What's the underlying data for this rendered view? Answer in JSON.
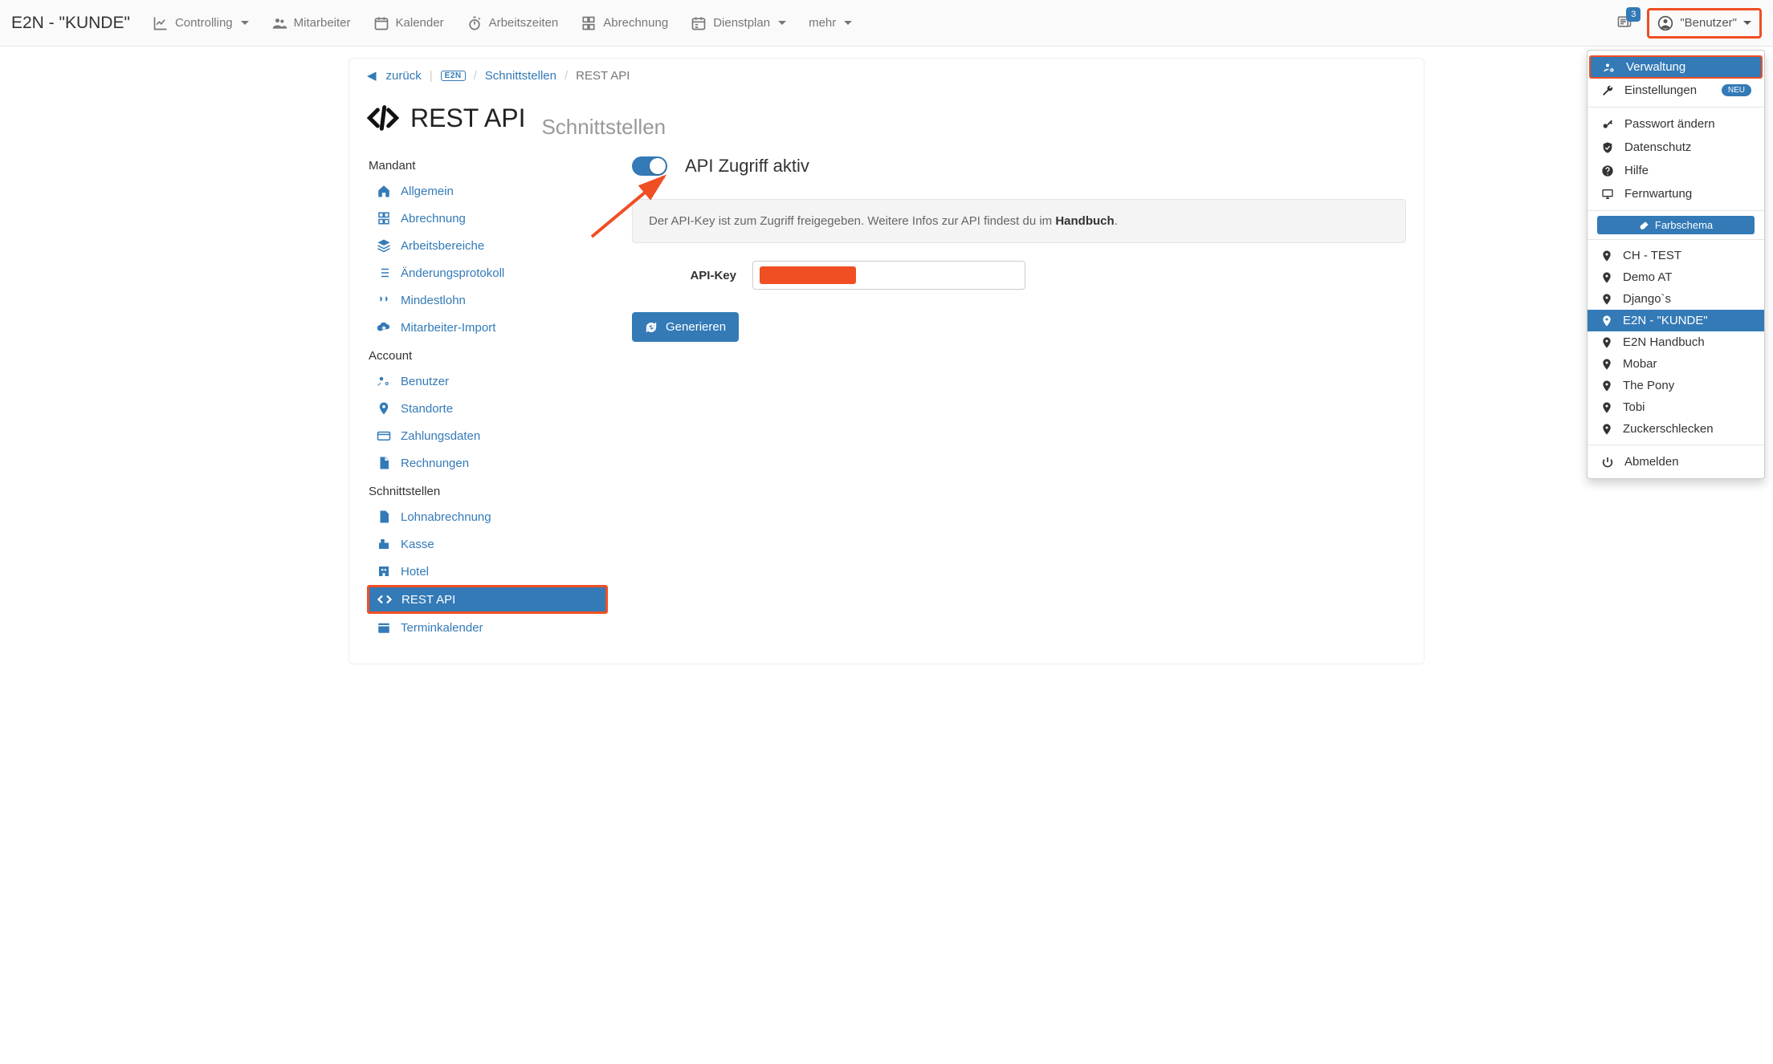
{
  "brand": "E2N - \"KUNDE\"",
  "nav": {
    "controlling": "Controlling",
    "mitarbeiter": "Mitarbeiter",
    "kalender": "Kalender",
    "arbeitszeiten": "Arbeitszeiten",
    "abrechnung": "Abrechnung",
    "dienstplan": "Dienstplan",
    "mehr": "mehr",
    "news_count": "3",
    "user_label": "\"Benutzer\""
  },
  "dropdown": {
    "verwaltung": "Verwaltung",
    "einstellungen": "Einstellungen",
    "neu_badge": "NEU",
    "passwort": "Passwort ändern",
    "datenschutz": "Datenschutz",
    "hilfe": "Hilfe",
    "fernwartung": "Fernwartung",
    "farbschema": "Farbschema",
    "contexts": [
      "CH - TEST",
      "Demo AT",
      "Django`s",
      "E2N - \"KUNDE\"",
      "E2N Handbuch",
      "Mobar",
      "The Pony",
      "Tobi",
      "Zuckerschlecken"
    ],
    "active_context_index": 3,
    "abmelden": "Abmelden"
  },
  "breadcrumbs": {
    "back": "zurück",
    "e2n_small": "E2N",
    "schnittstellen": "Schnittstellen",
    "current": "REST API"
  },
  "page": {
    "title": "REST API",
    "subtitle": "Schnittstellen"
  },
  "sidebar": {
    "section_mandant": "Mandant",
    "mandant": {
      "allgemein": "Allgemein",
      "abrechnung": "Abrechnung",
      "arbeitsbereiche": "Arbeitsbereiche",
      "aenderungsprotokoll": "Änderungsprotokoll",
      "mindestlohn": "Mindestlohn",
      "mitarbeiterimport": "Mitarbeiter-Import"
    },
    "section_account": "Account",
    "account": {
      "benutzer": "Benutzer",
      "standorte": "Standorte",
      "zahlungsdaten": "Zahlungsdaten",
      "rechnungen": "Rechnungen"
    },
    "section_schnittstellen": "Schnittstellen",
    "schnitt": {
      "lohnabrechnung": "Lohnabrechnung",
      "kasse": "Kasse",
      "hotel": "Hotel",
      "restapi": "REST API",
      "terminkalender": "Terminkalender"
    }
  },
  "content": {
    "toggle_title": "API Zugriff aktiv",
    "info_pre": "Der API-Key ist zum Zugriff freigegeben. Weitere Infos zur API findest du im ",
    "info_bold": "Handbuch",
    "info_post": ".",
    "api_key_label": "API-Key",
    "generate": "Generieren"
  }
}
